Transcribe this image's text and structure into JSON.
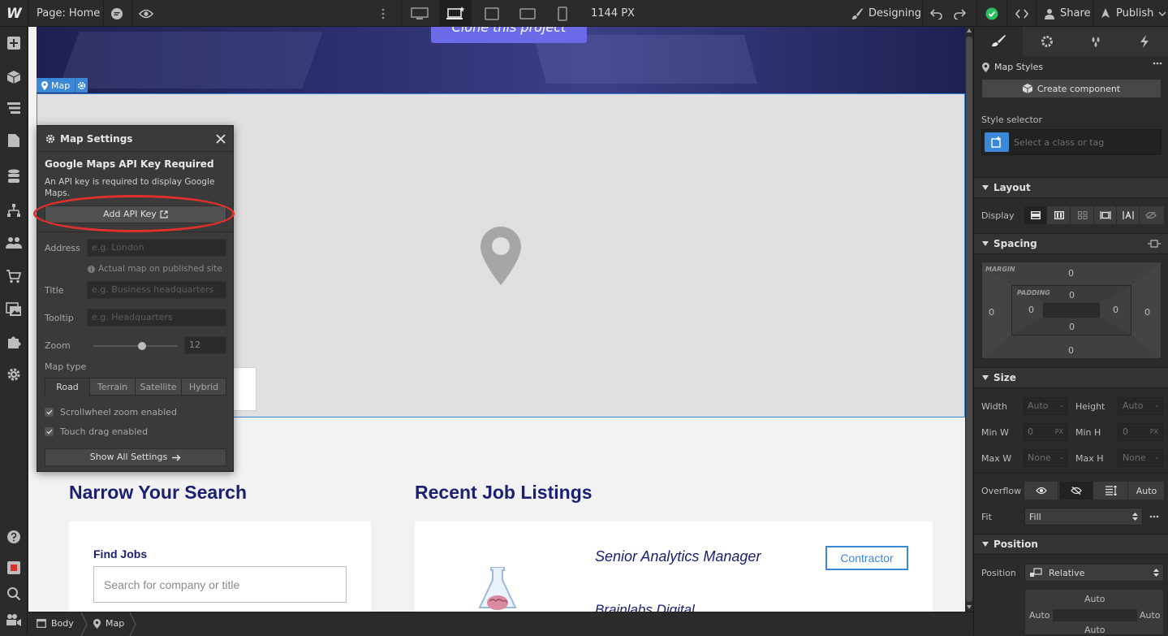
{
  "topbar": {
    "logo": "W",
    "page_prefix": "Page:",
    "page_name": "Home",
    "width_readout": "1144 PX",
    "mode": "Designing",
    "share": "Share",
    "publish": "Publish"
  },
  "canvas": {
    "clone_button": "Clone this project",
    "map_tag": "Map",
    "narrow_heading": "Narrow Your Search",
    "recent_heading": "Recent Job Listings",
    "find_jobs": "Find Jobs",
    "search_placeholder": "Search for company or title",
    "job_title": "Senior Analytics Manager",
    "job_company": "Brainlabs Digital",
    "contractor_badge": "Contractor"
  },
  "map_settings": {
    "title": "Map Settings",
    "api_heading": "Google Maps API Key Required",
    "api_desc": "An API key is required to display Google Maps.",
    "add_api_key": "Add API Key",
    "address_label": "Address",
    "address_placeholder": "e.g. London",
    "address_hint": "Actual map on published site",
    "title_label": "Title",
    "title_placeholder": "e.g. Business headquarters",
    "tooltip_label": "Tooltip",
    "tooltip_placeholder": "e.g. Headquarters",
    "zoom_label": "Zoom",
    "zoom_value": "12",
    "zoom_fraction": 0.58,
    "map_type_label": "Map type",
    "map_types": [
      "Road",
      "Terrain",
      "Satellite",
      "Hybrid"
    ],
    "scroll_zoom": "Scrollwheel zoom enabled",
    "touch_drag": "Touch drag enabled",
    "show_all": "Show All Settings"
  },
  "style_panel": {
    "element_label": "Map Styles",
    "create_component": "Create component",
    "style_selector": "Style selector",
    "selector_placeholder": "Select a class or tag",
    "layout": "Layout",
    "display_label": "Display",
    "spacing": "Spacing",
    "margin_label": "MARGIN",
    "padding_label": "PADDING",
    "margin_top": "0",
    "margin_right": "0",
    "margin_bottom": "0",
    "margin_left": "0",
    "padding_top": "0",
    "padding_right": "0",
    "padding_bottom": "0",
    "padding_left": "0",
    "size": "Size",
    "width_label": "Width",
    "width_value": "Auto",
    "width_unit": "-",
    "height_label": "Height",
    "height_value": "Auto",
    "height_unit": "-",
    "minw_label": "Min W",
    "minw_value": "0",
    "minw_unit": "PX",
    "minh_label": "Min H",
    "minh_value": "0",
    "minh_unit": "PX",
    "maxw_label": "Max W",
    "maxw_value": "None",
    "maxw_unit": "-",
    "maxh_label": "Max H",
    "maxh_value": "None",
    "maxh_unit": "-",
    "overflow_label": "Overflow",
    "overflow_auto": "Auto",
    "fit_label": "Fit",
    "fit_value": "Fill",
    "position": "Position",
    "position_label": "Position",
    "position_value": "Relative",
    "pos_top": "Auto",
    "pos_left": "Auto",
    "pos_right": "Auto",
    "pos_bottom": "Auto"
  },
  "breadcrumb": {
    "body": "Body",
    "map": "Map"
  },
  "colors": {
    "accent": "#3b87d8",
    "annotation": "#e0302b",
    "heading": "#1b2070",
    "publish_ok": "#2dbe60"
  }
}
